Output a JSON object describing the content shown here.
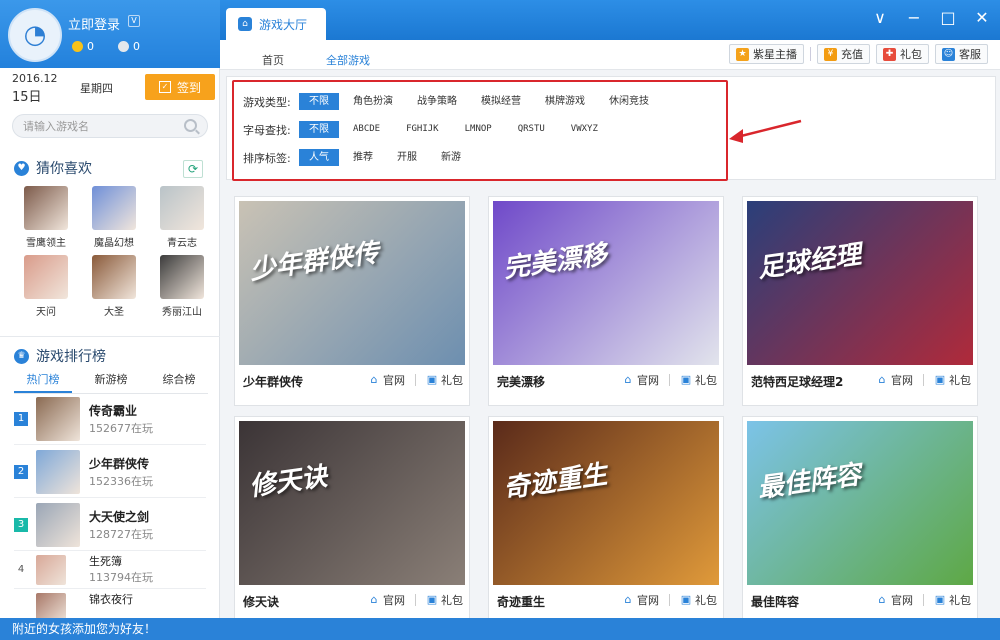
{
  "app": {
    "login_text": "立即登录",
    "coin_gold": "0",
    "coin_silver": "0",
    "main_tab": "游戏大厅"
  },
  "window_controls": [
    "∨",
    "−",
    "□",
    "✕"
  ],
  "subnav": {
    "home": "首页",
    "all_games": "全部游戏"
  },
  "top_buttons": {
    "stream": "紫星主播",
    "recharge": "充值",
    "gift": "礼包",
    "support": "客服"
  },
  "sidebar": {
    "date_ym": "2016.12",
    "date_day": "15日",
    "weekday": "星期四",
    "signin_label": "签到",
    "search_placeholder": "请输入游戏名",
    "guess_title": "猜你喜欢",
    "favorites": [
      {
        "name": "雪鹰领主",
        "color": "#7c5a4a"
      },
      {
        "name": "魔晶幻想",
        "color": "#6f8fd8"
      },
      {
        "name": "青云志",
        "color": "#b9c3c8"
      },
      {
        "name": "天问",
        "color": "#d99b8a"
      },
      {
        "name": "大圣",
        "color": "#8a5a3a"
      },
      {
        "name": "秀丽江山",
        "color": "#3b3b3b"
      }
    ],
    "rank_title": "游戏排行榜",
    "rank_tabs": [
      "热门榜",
      "新游榜",
      "综合榜"
    ],
    "rank_items": [
      {
        "num": "1",
        "name": "传奇霸业",
        "count": "152677在玩",
        "color": "#8a6a52"
      },
      {
        "num": "2",
        "name": "少年群侠传",
        "count": "152336在玩",
        "color": "#7fa8d8"
      },
      {
        "num": "3",
        "name": "大天使之剑",
        "count": "128727在玩",
        "color": "#9aa6b6"
      },
      {
        "num": "4",
        "name": "生死簿",
        "count": "113794在玩",
        "color": "#d8a898"
      },
      {
        "num": "",
        "name": "锦衣夜行",
        "count": "",
        "color": "#a87868"
      }
    ]
  },
  "filter": {
    "type_label": "游戏类型:",
    "type_options": [
      "不限",
      "角色扮演",
      "战争策略",
      "模拟经营",
      "棋牌游戏",
      "休闲竞技"
    ],
    "letter_label": "字母查找:",
    "letter_options": [
      "不限",
      "ABCDE",
      "FGHIJK",
      "LMNOP",
      "QRSTU",
      "VWXYZ"
    ],
    "sort_label": "排序标签:",
    "sort_options": [
      "人气",
      "推荐",
      "开服",
      "新游"
    ]
  },
  "games": [
    {
      "title": "少年群侠传",
      "art_text": "少年群侠传",
      "c1": "#c9c2b4",
      "c2": "#6d8fb0"
    },
    {
      "title": "完美漂移",
      "art_text": "完美漂移",
      "c1": "#6f49c9",
      "c2": "#e2e4ec"
    },
    {
      "title": "范特西足球经理2",
      "art_text": "足球经理",
      "c1": "#2a3f7a",
      "c2": "#b02a3a"
    },
    {
      "title": "修天诀",
      "art_text": "修天诀",
      "c1": "#3b3436",
      "c2": "#8a7f77"
    },
    {
      "title": "奇迹重生",
      "art_text": "奇迹重生",
      "c1": "#5a2a1a",
      "c2": "#e09a3a"
    },
    {
      "title": "最佳阵容",
      "art_text": "最佳阵容",
      "c1": "#7cc3e8",
      "c2": "#5ea845"
    }
  ],
  "card_links": {
    "official": "官网",
    "gift": "礼包"
  },
  "status_text": "附近的女孩添加您为好友！",
  "colors": {
    "accent": "#2a82d8",
    "signin": "#f7a21c",
    "highlight_box": "#d9262c"
  }
}
